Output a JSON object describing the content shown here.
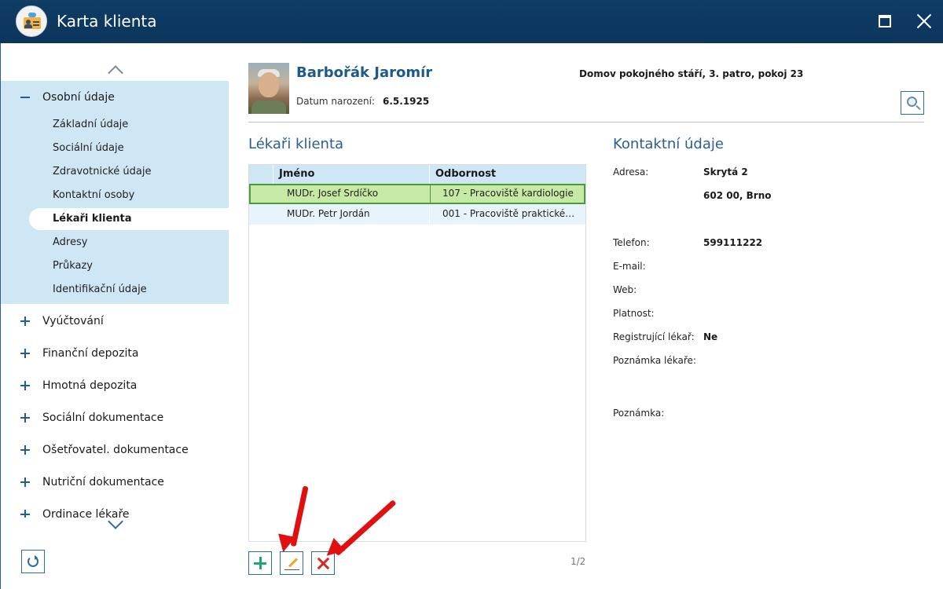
{
  "window": {
    "title": "Karta klienta"
  },
  "sidebar": {
    "open_group": {
      "label": "Osobní údaje",
      "items": [
        {
          "label": "Základní údaje",
          "active": false
        },
        {
          "label": "Sociální údaje",
          "active": false
        },
        {
          "label": "Zdravotnické údaje",
          "active": false
        },
        {
          "label": "Kontaktní osoby",
          "active": false
        },
        {
          "label": "Lékaři klienta",
          "active": true
        },
        {
          "label": "Adresy",
          "active": false
        },
        {
          "label": "Průkazy",
          "active": false
        },
        {
          "label": "Identifikační údaje",
          "active": false
        }
      ]
    },
    "groups": [
      {
        "label": "Vyúčtování"
      },
      {
        "label": "Finanční depozita"
      },
      {
        "label": "Hmotná depozita"
      },
      {
        "label": "Sociální dokumentace"
      },
      {
        "label": "Ošetřovatel. dokumentace"
      },
      {
        "label": "Nutriční dokumentace"
      },
      {
        "label": "Ordinace lékaře"
      }
    ]
  },
  "client": {
    "name": "Barbořák Jaromír",
    "birth_label": "Datum narození:",
    "birth_date": "6.5.1925",
    "residence": "Domov pokojného stáří, 3. patro, pokoj 23"
  },
  "doctors": {
    "title": "Lékaři klienta",
    "columns": [
      "Jméno",
      "Odbornost"
    ],
    "rows": [
      {
        "name": "MUDr. Josef Srdíčko",
        "specialty": "107 - Pracoviště kardiologie",
        "selected": true
      },
      {
        "name": "MUDr. Petr Jordán",
        "specialty": "001 - Pracoviště praktické…",
        "selected": false
      }
    ],
    "pager": "1/2"
  },
  "contact": {
    "title": "Kontaktní údaje",
    "address_label": "Adresa:",
    "address_line1": "Skrytá 2",
    "address_line2": "602 00, Brno",
    "phone_label": "Telefon:",
    "phone_value": "599111222",
    "email_label": "E-mail:",
    "web_label": "Web:",
    "validity_label": "Platnost:",
    "registering_label": "Registrující lékař:",
    "registering_value": "Ne",
    "doctor_note_label": "Poznámka lékaře:",
    "note_label": "Poznámka:"
  },
  "colors": {
    "titlebar": "#0f3d66",
    "sidebar_highlight": "#cfe6f5",
    "selected_row": "#c6eaa5",
    "annotation_arrow": "#e01010"
  },
  "icons": [
    "app-icon",
    "maximize-icon",
    "close-icon",
    "chevron-up-icon",
    "chevron-down-icon",
    "minus-icon",
    "plus-icon",
    "refresh-icon",
    "search-icon",
    "add-icon",
    "edit-icon",
    "delete-icon"
  ]
}
